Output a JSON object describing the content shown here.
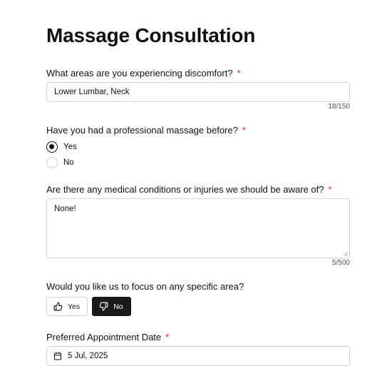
{
  "title": "Massage Consultation",
  "required_mark": "*",
  "q1": {
    "label": "What areas are you experiencing discomfort?",
    "value": "Lower Lumbar, Neck",
    "counter": "18/150"
  },
  "q2": {
    "label": "Have you had a professional massage before?",
    "options": [
      {
        "label": "Yes",
        "selected": true
      },
      {
        "label": "No",
        "selected": false
      }
    ]
  },
  "q3": {
    "label": "Are there any medical conditions or injuries we should be aware of?",
    "value": "None!",
    "counter": "5/500"
  },
  "q4": {
    "label": "Would you like us to focus on any specific area?",
    "yes_label": "Yes",
    "no_label": "No",
    "selected": "No",
    "yes_icon": "thumbs-up-icon",
    "no_icon": "thumbs-down-icon"
  },
  "q5": {
    "label": "Preferred Appointment Date",
    "value": "5 Jul, 2025",
    "icon": "calendar-icon"
  },
  "colors": {
    "required": "#e11d48",
    "active_toggle_bg": "#1a1a1a",
    "border": "#d4d4d4"
  }
}
